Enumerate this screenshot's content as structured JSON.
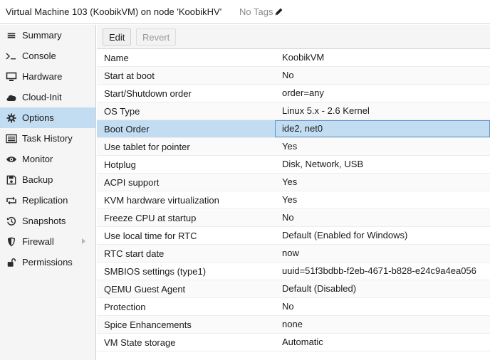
{
  "header": {
    "title": "Virtual Machine 103 (KoobikVM) on node 'KoobikHV'",
    "tags_label": "No Tags",
    "tags_icon": "pencil-icon"
  },
  "sidebar": {
    "items": [
      {
        "label": "Summary",
        "icon": "summary-icon"
      },
      {
        "label": "Console",
        "icon": "console-icon"
      },
      {
        "label": "Hardware",
        "icon": "hardware-icon"
      },
      {
        "label": "Cloud-Init",
        "icon": "cloud-icon"
      },
      {
        "label": "Options",
        "icon": "gear-icon",
        "active": true
      },
      {
        "label": "Task History",
        "icon": "task-history-icon"
      },
      {
        "label": "Monitor",
        "icon": "eye-icon"
      },
      {
        "label": "Backup",
        "icon": "floppy-icon"
      },
      {
        "label": "Replication",
        "icon": "replication-icon"
      },
      {
        "label": "Snapshots",
        "icon": "history-icon"
      },
      {
        "label": "Firewall",
        "icon": "shield-icon",
        "has_submenu": true
      },
      {
        "label": "Permissions",
        "icon": "unlock-icon"
      }
    ]
  },
  "toolbar": {
    "edit_label": "Edit",
    "revert_label": "Revert"
  },
  "options": {
    "selected_index": 4,
    "rows": [
      {
        "name": "Name",
        "value": "KoobikVM"
      },
      {
        "name": "Start at boot",
        "value": "No"
      },
      {
        "name": "Start/Shutdown order",
        "value": "order=any"
      },
      {
        "name": "OS Type",
        "value": "Linux 5.x - 2.6 Kernel"
      },
      {
        "name": "Boot Order",
        "value": "ide2, net0"
      },
      {
        "name": "Use tablet for pointer",
        "value": "Yes"
      },
      {
        "name": "Hotplug",
        "value": "Disk, Network, USB"
      },
      {
        "name": "ACPI support",
        "value": "Yes"
      },
      {
        "name": "KVM hardware virtualization",
        "value": "Yes"
      },
      {
        "name": "Freeze CPU at startup",
        "value": "No"
      },
      {
        "name": "Use local time for RTC",
        "value": "Default (Enabled for Windows)"
      },
      {
        "name": "RTC start date",
        "value": "now"
      },
      {
        "name": "SMBIOS settings (type1)",
        "value": "uuid=51f3bdbb-f2eb-4671-b828-e24c9a4ea056"
      },
      {
        "name": "QEMU Guest Agent",
        "value": "Default (Disabled)"
      },
      {
        "name": "Protection",
        "value": "No"
      },
      {
        "name": "Spice Enhancements",
        "value": "none"
      },
      {
        "name": "VM State storage",
        "value": "Automatic"
      }
    ]
  },
  "colors": {
    "selection": "#c2ddf2",
    "selection_border": "#5e97c9",
    "sidebar_bg": "#f5f5f5"
  }
}
